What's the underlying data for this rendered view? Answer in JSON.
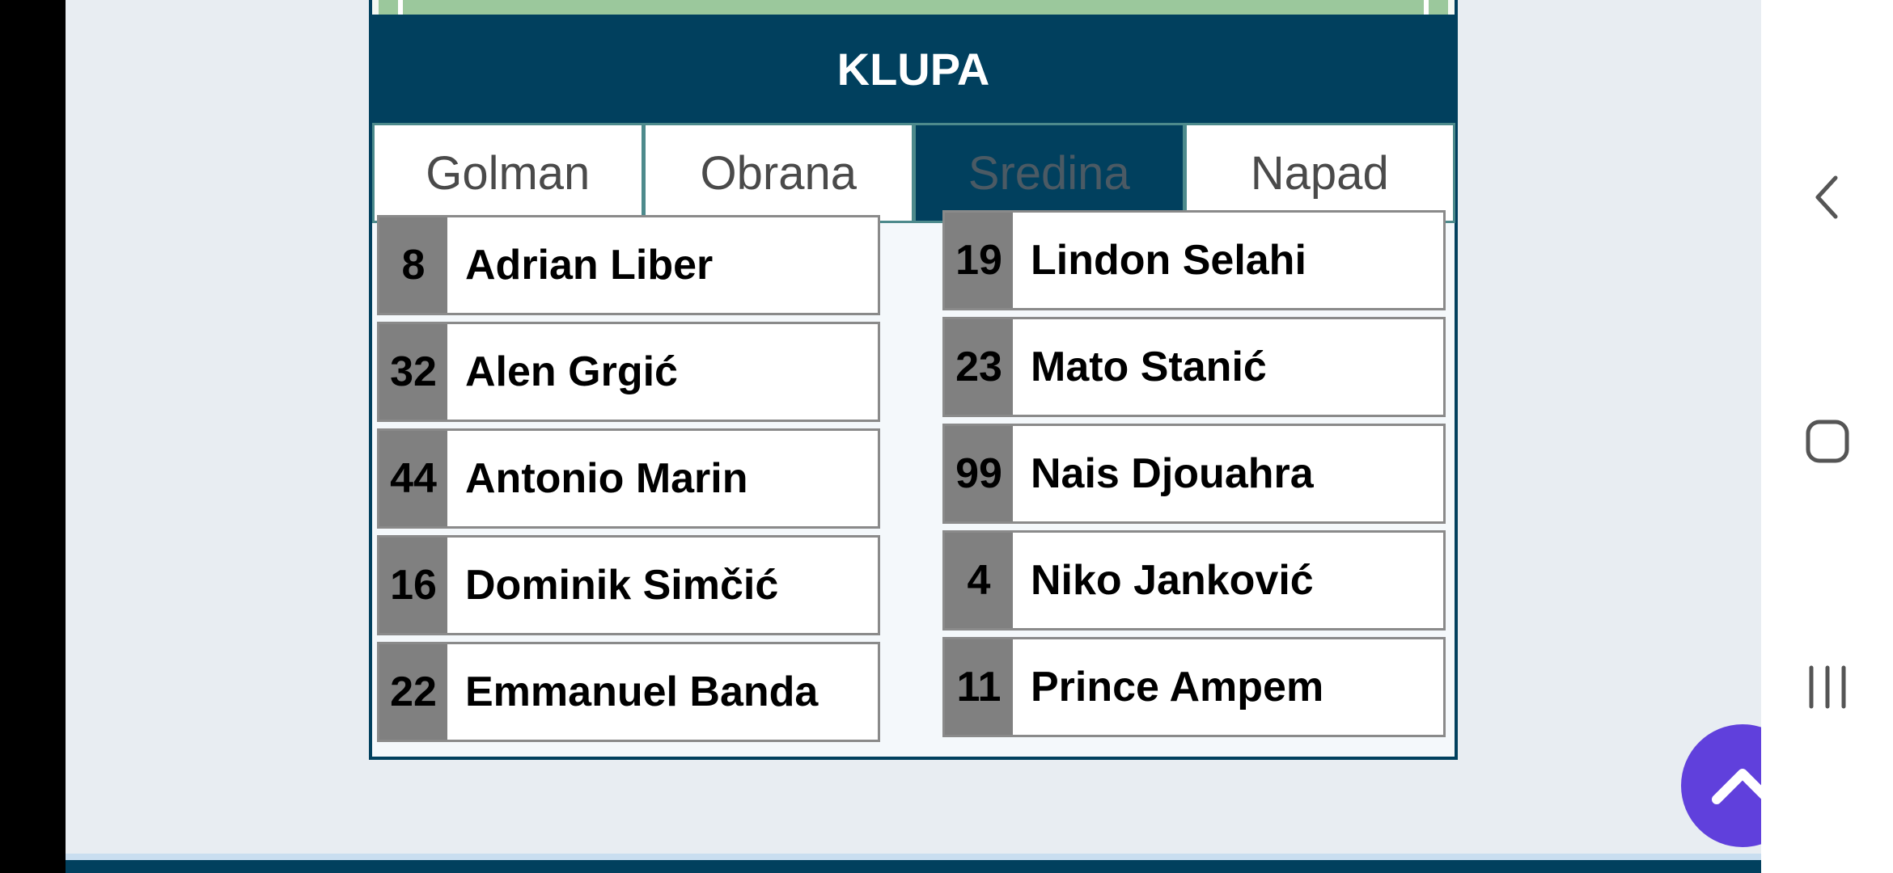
{
  "bench": {
    "title": "KLUPA",
    "tabs": [
      {
        "label": "Golman",
        "active": false
      },
      {
        "label": "Obrana",
        "active": false
      },
      {
        "label": "Sredina",
        "active": true
      },
      {
        "label": "Napad",
        "active": false
      }
    ],
    "players_left": [
      {
        "number": "8",
        "name": "Adrian Liber"
      },
      {
        "number": "32",
        "name": "Alen Grgić"
      },
      {
        "number": "44",
        "name": "Antonio Marin"
      },
      {
        "number": "16",
        "name": "Dominik Simčić"
      },
      {
        "number": "22",
        "name": "Emmanuel Banda"
      }
    ],
    "players_right": [
      {
        "number": "19",
        "name": "Lindon Selahi"
      },
      {
        "number": "23",
        "name": "Mato Stanić"
      },
      {
        "number": "99",
        "name": "Nais Djouahra"
      },
      {
        "number": "4",
        "name": "Niko Janković"
      },
      {
        "number": "11",
        "name": "Prince Ampem"
      }
    ]
  },
  "icons": {
    "scroll_top": "chevron-up-icon",
    "nav_back": "back-icon",
    "nav_home": "home-icon",
    "nav_recents": "recents-icon"
  },
  "colors": {
    "header": "#01405e",
    "fab": "#6040dc",
    "number_bg": "#808080"
  }
}
